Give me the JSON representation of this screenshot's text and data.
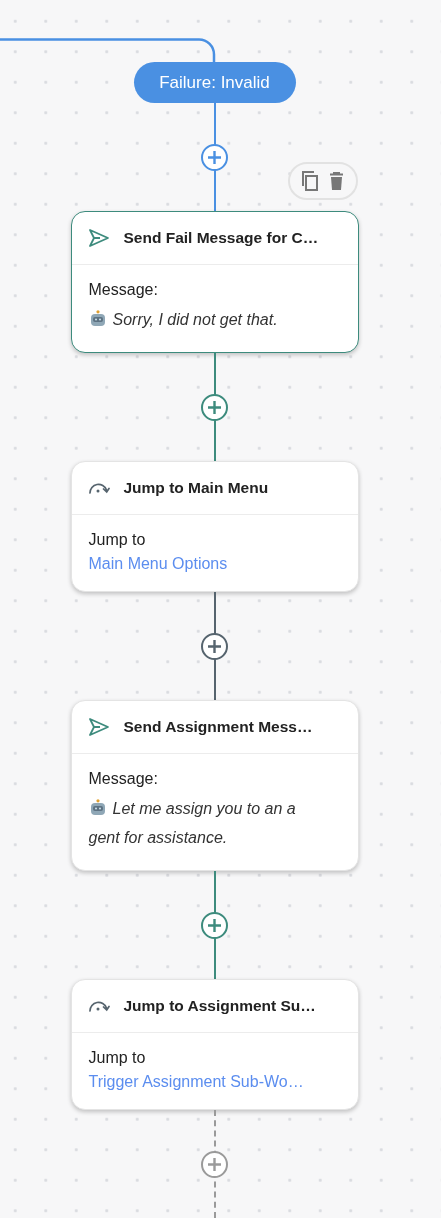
{
  "branch": {
    "label": "Failure: Invalid",
    "color": "#4a90e2"
  },
  "connectors": [
    {
      "kind": "solid",
      "color": "#4a90e2"
    },
    {
      "kind": "solid",
      "color": "#3d8b7d"
    },
    {
      "kind": "solid",
      "color": "#56646e"
    },
    {
      "kind": "solid",
      "color": "#3d8b7d"
    },
    {
      "kind": "dashed",
      "color": "#9a9a9a"
    }
  ],
  "steps": [
    {
      "kind": "message",
      "title": "Send Fail Message for C…",
      "selected": true,
      "label": "Message:",
      "value": "Sorry, I did not get that."
    },
    {
      "kind": "jump",
      "title": "Jump to Main Menu",
      "selected": false,
      "label": "Jump to",
      "value": "Main Menu Options"
    },
    {
      "kind": "message",
      "title": "Send Assignment Mess…",
      "selected": false,
      "label": "Message:",
      "value": "Let me assign you to an agent for assistance."
    },
    {
      "kind": "jump",
      "title": "Jump to Assignment Su…",
      "selected": false,
      "label": "Jump to",
      "value": "Trigger Assignment Sub-Wo…"
    }
  ]
}
